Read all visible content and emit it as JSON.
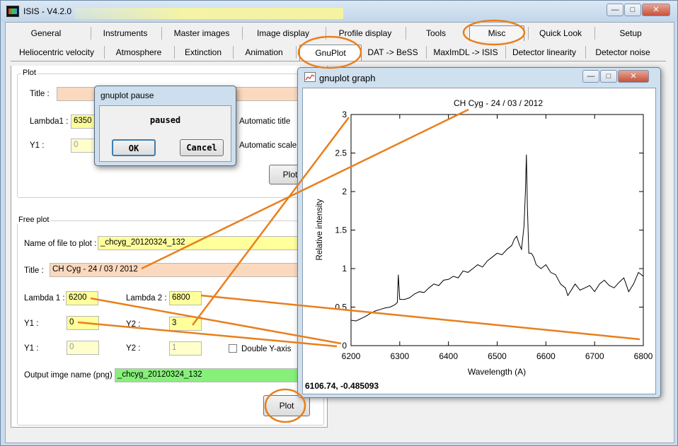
{
  "window": {
    "title": "ISIS - V4.2.0",
    "min_symbol": "—",
    "max_symbol": "□",
    "close_symbol": "✕"
  },
  "tabs_row1": [
    "General",
    "Instruments",
    "Master images",
    "Image display",
    "Profile display",
    "Tools",
    "Misc",
    "Quick Look",
    "Setup"
  ],
  "tabs_row2": [
    "Heliocentric velocity",
    "Atmosphere",
    "Extinction",
    "Animation",
    "GnuPlot",
    "DAT -> BeSS",
    "MaxImDL -> ISIS",
    "Detector linearity",
    "Detector noise"
  ],
  "plot_group": {
    "label": "Plot",
    "title_label": "Title :",
    "lambda1_label": "Lambda1 :",
    "lambda1_value": "6350",
    "y1_label": "Y1 :",
    "y1_value": "0",
    "auto_title": "Automatic title",
    "auto_scale": "Automatic scale",
    "plot_button": "Plot"
  },
  "free_plot": {
    "label": "Free plot",
    "file_label": "Name of file to plot :",
    "file_value": "_chcyg_20120324_132",
    "title_label": "Title :",
    "title_value": "CH Cyg - 24 / 03 / 2012",
    "lambda1_label": "Lambda 1 :",
    "lambda1_value": "6200",
    "lambda2_label": "Lambda 2 :",
    "lambda2_value": "6800",
    "y1_label": "Y1 :",
    "y1_value": "0",
    "y2_label": "Y2 :",
    "y2_value": "3",
    "y1b_label": "Y1 :",
    "y1b_value": "0",
    "y2b_label": "Y2 :",
    "y2b_value": "1",
    "double_y": "Double Y-axis",
    "output_label": "Output imge name (png) :",
    "output_value": "_chcyg_20120324_132",
    "plot_button": "Plot"
  },
  "pause_dialog": {
    "title": "gnuplot pause",
    "message": "paused",
    "ok": "OK",
    "cancel": "Cancel"
  },
  "graph_window": {
    "title": "gnuplot graph",
    "coords": "6106.74, -0.485093"
  },
  "chart_data": {
    "type": "line",
    "title": "CH Cyg - 24 / 03 / 2012",
    "xlabel": "Wavelength (A)",
    "ylabel": "Relative intensity",
    "xlim": [
      6200,
      6800
    ],
    "ylim": [
      0,
      3
    ],
    "xticks": [
      6200,
      6300,
      6400,
      6500,
      6600,
      6700,
      6800
    ],
    "yticks": [
      0,
      0.5,
      1,
      1.5,
      2,
      2.5,
      3
    ],
    "grid": false,
    "x": [
      6200,
      6210,
      6220,
      6230,
      6240,
      6250,
      6260,
      6270,
      6280,
      6290,
      6295,
      6297,
      6300,
      6305,
      6310,
      6320,
      6330,
      6340,
      6350,
      6360,
      6370,
      6380,
      6390,
      6400,
      6410,
      6420,
      6430,
      6440,
      6450,
      6460,
      6470,
      6480,
      6490,
      6500,
      6510,
      6520,
      6530,
      6535,
      6540,
      6545,
      6550,
      6555,
      6558,
      6560,
      6562,
      6565,
      6570,
      6575,
      6580,
      6590,
      6600,
      6610,
      6620,
      6630,
      6640,
      6645,
      6650,
      6655,
      6660,
      6670,
      6680,
      6690,
      6700,
      6710,
      6720,
      6730,
      6740,
      6750,
      6760,
      6770,
      6780,
      6790,
      6800
    ],
    "y": [
      0.33,
      0.32,
      0.35,
      0.38,
      0.42,
      0.45,
      0.47,
      0.49,
      0.5,
      0.53,
      0.56,
      0.92,
      0.6,
      0.6,
      0.6,
      0.62,
      0.67,
      0.7,
      0.69,
      0.75,
      0.8,
      0.78,
      0.85,
      0.86,
      0.9,
      0.88,
      0.97,
      0.95,
      1.0,
      1.05,
      1.02,
      1.1,
      1.15,
      1.2,
      1.18,
      1.25,
      1.3,
      1.38,
      1.42,
      1.32,
      1.25,
      1.55,
      2.0,
      2.48,
      1.8,
      1.2,
      1.2,
      1.15,
      1.05,
      1.0,
      1.05,
      0.95,
      0.92,
      0.8,
      0.75,
      0.65,
      0.7,
      0.75,
      0.8,
      0.72,
      0.75,
      0.78,
      0.7,
      0.8,
      0.85,
      0.78,
      0.75,
      0.82,
      0.88,
      0.7,
      0.8,
      0.95,
      0.9
    ]
  }
}
